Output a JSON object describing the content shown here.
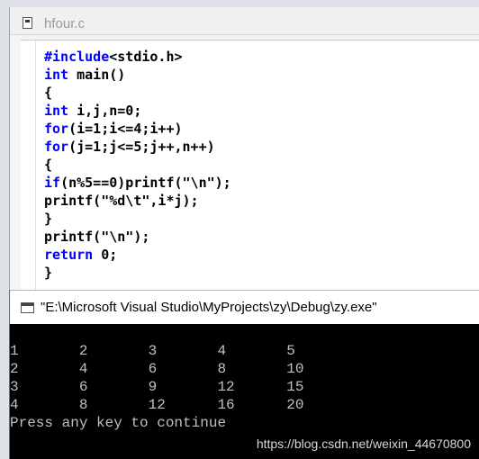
{
  "editor": {
    "title": "hfour.c",
    "code": [
      {
        "kw": "#include",
        "rest": "<stdio.h>"
      },
      {
        "kw": "int",
        "rest": " main()"
      },
      {
        "kw": "",
        "rest": "{"
      },
      {
        "kw": "int",
        "rest": " i,j,n=0;"
      },
      {
        "kw": "for",
        "rest": "(i=1;i<=4;i++)"
      },
      {
        "kw": "for",
        "rest": "(j=1;j<=5;j++,n++)"
      },
      {
        "kw": "",
        "rest": "{"
      },
      {
        "kw": "if",
        "rest": "(n%5==0)printf(\"\\n\");"
      },
      {
        "kw": "",
        "rest": "printf(\"%d\\t\",i*j);"
      },
      {
        "kw": "",
        "rest": "}"
      },
      {
        "kw": "",
        "rest": "printf(\"\\n\");"
      },
      {
        "kw": "return",
        "rest": " 0;"
      },
      {
        "kw": "",
        "rest": "}"
      }
    ]
  },
  "console": {
    "title": "\"E:\\Microsoft Visual Studio\\MyProjects\\zy\\Debug\\zy.exe\"",
    "lines": [
      "1       2       3       4       5",
      "2       4       6       8       10",
      "3       6       9       12      15",
      "4       8       12      16      20",
      "Press any key to continue"
    ]
  },
  "watermark": "https://blog.csdn.net/weixin_44670800",
  "colors": {
    "keyword": "#0000ff",
    "console_bg": "#000000",
    "console_text": "#c0c0c0"
  }
}
